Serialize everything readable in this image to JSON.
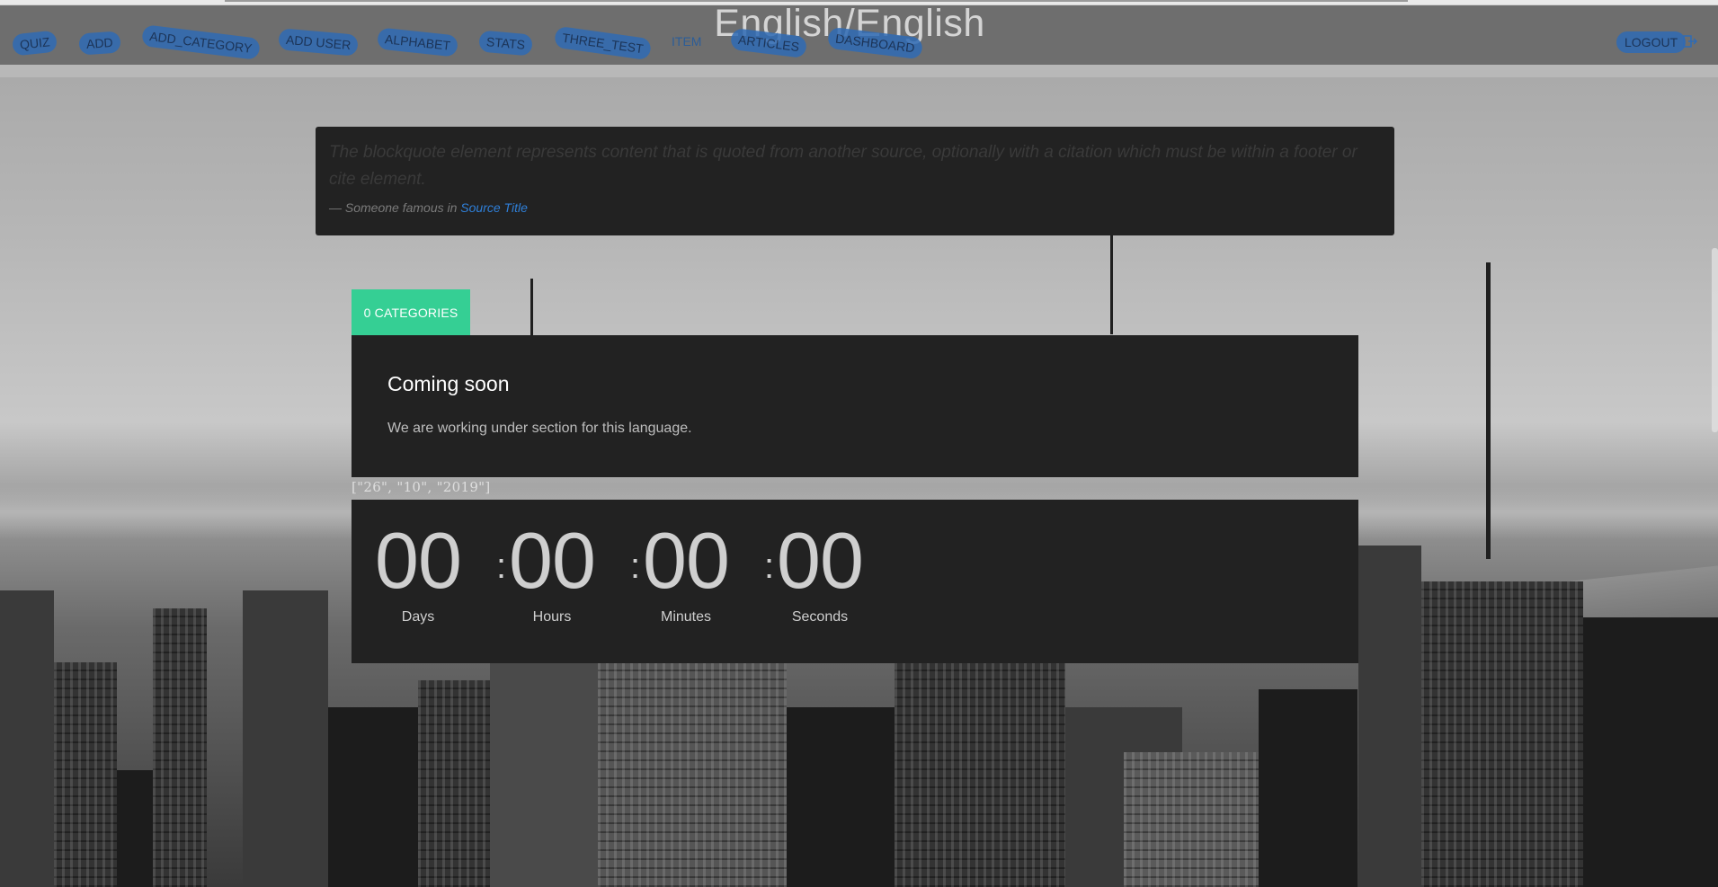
{
  "header": {
    "title": "English/English"
  },
  "nav": {
    "items": [
      {
        "label": "QUIZ"
      },
      {
        "label": "ADD"
      },
      {
        "label": "ADD_CATEGORY"
      },
      {
        "label": "ADD USER"
      },
      {
        "label": "ALPHABET"
      },
      {
        "label": "STATS"
      },
      {
        "label": "THREE_TEST"
      },
      {
        "label": "ITEM"
      },
      {
        "label": "ARTICLES"
      },
      {
        "label": "DASHBOARD"
      }
    ],
    "logout_label": "LOGOUT",
    "logout_icon": "logout-icon"
  },
  "blockquote": {
    "text": "The blockquote element represents content that is quoted from another source, optionally with a citation which must be within a footer or cite element.",
    "footer_prefix": "— Someone famous in ",
    "source_title": "Source Title"
  },
  "categories": {
    "tab_label": "0 CATEGORIES",
    "panel_title": "Coming soon",
    "panel_text": "We are working under section for this language."
  },
  "date_raw": "[\"26\", \"10\", \"2019\"]",
  "countdown": {
    "days": "00",
    "hours": "00",
    "minutes": "00",
    "seconds": "00",
    "days_label": "Days",
    "hours_label": "Hours",
    "minutes_label": "Minutes",
    "seconds_label": "Seconds",
    "separator": ":"
  },
  "colors": {
    "accent_green": "#35cf94",
    "nav_blue": "#2f6bb5",
    "panel_bg": "#222222",
    "link_blue": "#2f7fd8"
  }
}
